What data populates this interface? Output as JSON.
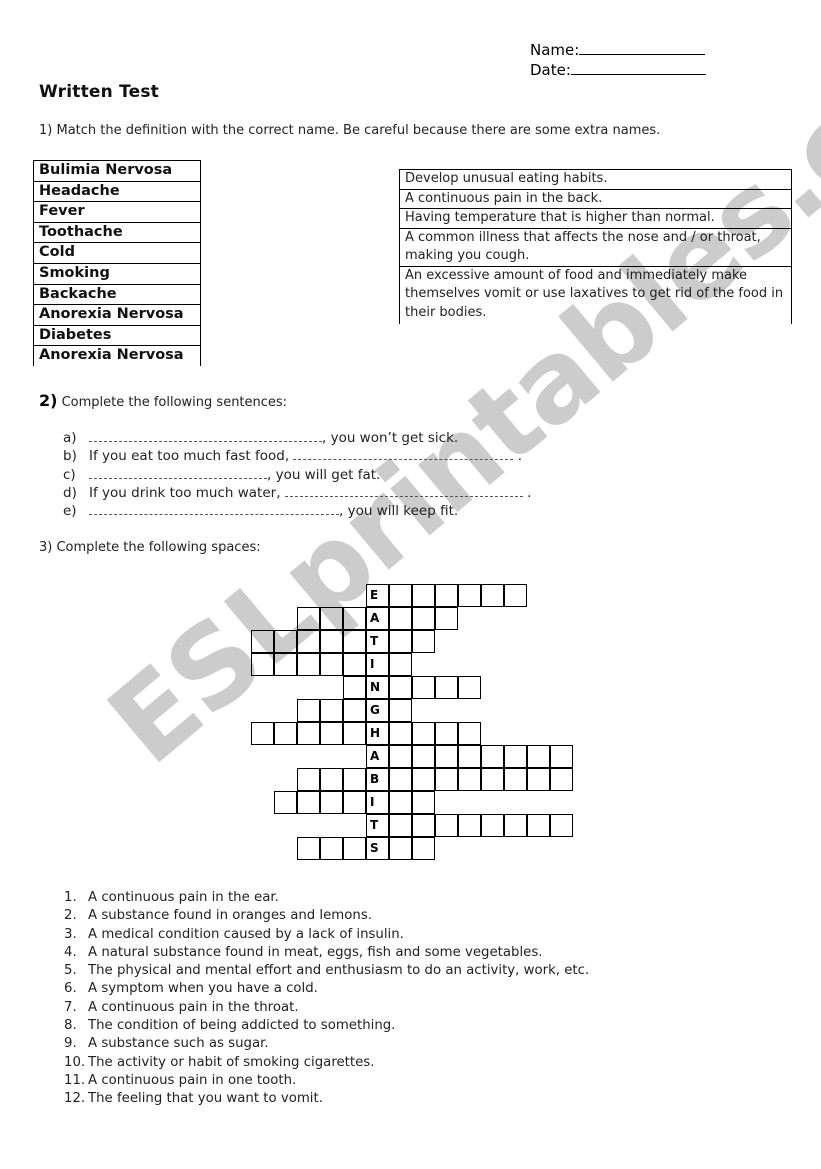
{
  "header": {
    "name_label": "Name:",
    "date_label": "Date:",
    "title": "Written Test"
  },
  "section1": {
    "number": "1)",
    "instruction": "Match the definition with the correct name. Be careful because there are some extra names.",
    "names": [
      "Bulimia Nervosa",
      "Headache",
      "Fever",
      "Toothache",
      "Cold",
      "Smoking",
      "Backache",
      "Anorexia Nervosa",
      "Diabetes",
      "Anorexia Nervosa"
    ],
    "definitions": [
      "Develop unusual eating habits.",
      "A continuous pain in the back.",
      "Having temperature that is higher than normal.",
      "A common illness that affects the nose and / or throat, making you cough.",
      "An excessive amount of food and immediately make themselves vomit or use laxatives to get rid of the food in their bodies."
    ]
  },
  "section2": {
    "number": "2)",
    "instruction": "Complete the following sentences:",
    "sentences": [
      {
        "label": "a)",
        "before": "",
        "after": ", you won’t get sick."
      },
      {
        "label": "b)",
        "before": "If you eat too much fast food, ",
        "after": " ."
      },
      {
        "label": "c)",
        "before": "",
        "after": ", you will get fat."
      },
      {
        "label": "d)",
        "before": "If you drink too much water, ",
        "after": " ."
      },
      {
        "label": "e)",
        "before": "",
        "after": ", you will keep fit."
      }
    ]
  },
  "section3": {
    "number": "3)",
    "instruction": "Complete the following spaces:",
    "key_word": "EATINGHABITS",
    "rows": [
      {
        "key": "E",
        "before": 0,
        "after": 6
      },
      {
        "key": "A",
        "before": 3,
        "after": 3
      },
      {
        "key": "T",
        "before": 5,
        "after": 2
      },
      {
        "key": "I",
        "before": 5,
        "after": 1
      },
      {
        "key": "N",
        "before": 1,
        "after": 4
      },
      {
        "key": "G",
        "before": 3,
        "after": 1
      },
      {
        "key": "H",
        "before": 5,
        "after": 4
      },
      {
        "key": "A",
        "before": 0,
        "after": 8
      },
      {
        "key": "B",
        "before": 3,
        "after": 8
      },
      {
        "key": "I",
        "before": 4,
        "after": 2
      },
      {
        "key": "T",
        "before": 0,
        "after": 8
      },
      {
        "key": "S",
        "before": 3,
        "after": 2
      }
    ],
    "clues": [
      {
        "num": "1.",
        "text": "A continuous pain in the ear."
      },
      {
        "num": "2.",
        "text": "A substance found in oranges and lemons."
      },
      {
        "num": "3.",
        "text": "A medical condition caused by a lack of insulin."
      },
      {
        "num": "4.",
        "text": "A natural substance found in meat, eggs, fish and some vegetables."
      },
      {
        "num": "5.",
        "text": "The physical and mental effort and enthusiasm to do an activity, work, etc."
      },
      {
        "num": "6.",
        "text": "A symptom when you have a cold."
      },
      {
        "num": "7.",
        "text": "A continuous pain in the throat."
      },
      {
        "num": "8.",
        "text": "The condition of being addicted to something."
      },
      {
        "num": "9.",
        "text": "A substance such as sugar."
      },
      {
        "num": "10.",
        "text": "The activity or habit of smoking cigarettes."
      },
      {
        "num": "11.",
        "text": "A continuous pain in one tooth."
      },
      {
        "num": "12.",
        "text": "The feeling that you want to vomit."
      }
    ]
  },
  "watermark": {
    "text": "ESLprintables.com",
    "color": "#c4c4c4"
  }
}
